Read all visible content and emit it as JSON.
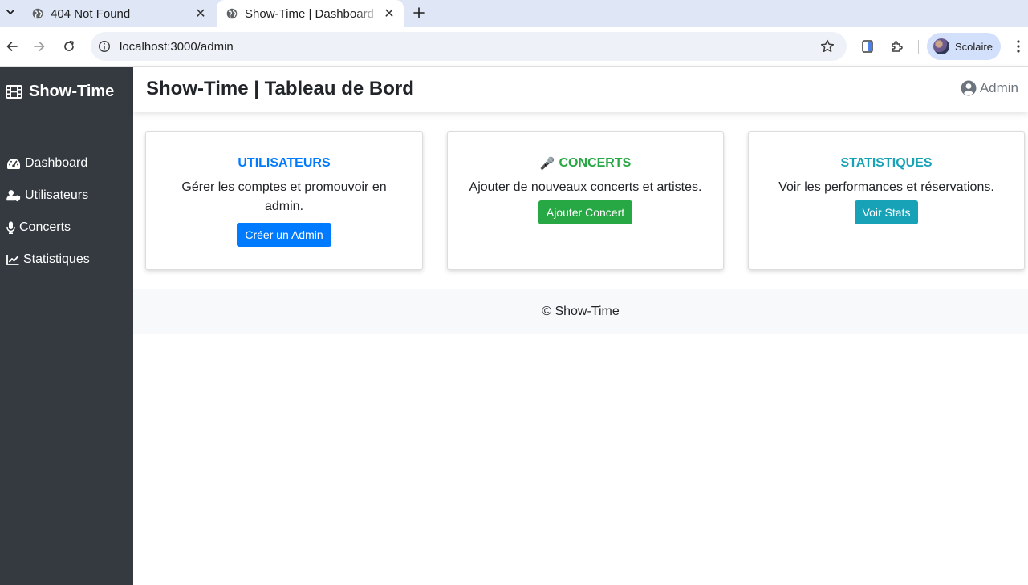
{
  "browser": {
    "tabs": [
      {
        "title": "404 Not Found",
        "active": false
      },
      {
        "title": "Show-Time | Dashboard",
        "active": true
      }
    ],
    "url": "localhost:3000/admin",
    "profile_name": "Scolaire"
  },
  "sidebar": {
    "brand": "Show-Time",
    "items": [
      {
        "label": "Dashboard",
        "icon": "tachometer-icon"
      },
      {
        "label": "Utilisateurs",
        "icon": "user-shield-icon"
      },
      {
        "label": "Concerts",
        "icon": "microphone-icon"
      },
      {
        "label": "Statistiques",
        "icon": "chart-line-icon"
      }
    ]
  },
  "header": {
    "title": "Show-Time | Tableau de Bord",
    "user_label": "Admin"
  },
  "cards": [
    {
      "title": "UTILISATEURS",
      "text": "Gérer les comptes et promouvoir en admin.",
      "button": "Créer un Admin",
      "color": "#007bff"
    },
    {
      "title": "CONCERTS",
      "emoji": "🎤",
      "text": "Ajouter de nouveaux concerts et artistes.",
      "button": "Ajouter Concert",
      "color": "#28a745"
    },
    {
      "title": "STATISTIQUES",
      "text": "Voir les performances et réservations.",
      "button": "Voir Stats",
      "color": "#17a2b8"
    }
  ],
  "footer": {
    "text": "© Show-Time"
  },
  "colors": {
    "sidebar_bg": "#343a40",
    "footer_bg": "#f8f9fa",
    "tabstrip_bg": "#dfe6f6"
  }
}
